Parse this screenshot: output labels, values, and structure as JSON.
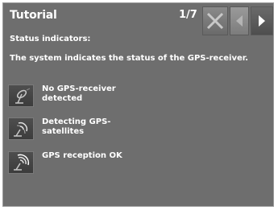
{
  "header": {
    "title": "Tutorial",
    "page_indicator": "1/7"
  },
  "toolbar": {
    "close_icon": "close-icon",
    "prev_icon": "arrow-left-icon",
    "next_icon": "arrow-right-icon"
  },
  "content": {
    "subtitle": "Status indicators:",
    "description": "The system indicates the status of the GPS-receiver.",
    "indicators": [
      {
        "icon": "gps-no-receiver-icon",
        "label": "No GPS-receiver detected"
      },
      {
        "icon": "gps-detecting-icon",
        "label": "Detecting GPS-satellites"
      },
      {
        "icon": "gps-ok-icon",
        "label": "GPS reception OK"
      }
    ]
  }
}
